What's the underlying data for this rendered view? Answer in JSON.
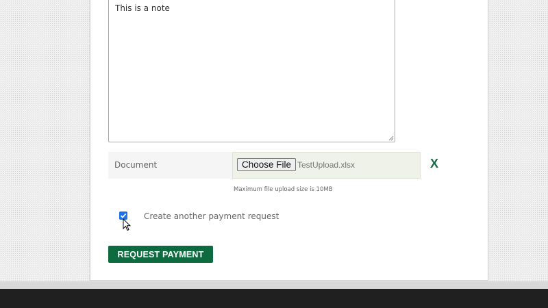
{
  "notes": {
    "value": "This is a note"
  },
  "document": {
    "label": "Document",
    "choose_label": "Choose File",
    "file_name": "TestUpload.xlsx",
    "remove_label": "X",
    "hint": "Maximum file upload size is 10MB"
  },
  "options": {
    "create_another_label": "Create another payment request",
    "create_another_checked": true
  },
  "actions": {
    "submit_label": "REQUEST PAYMENT"
  },
  "colors": {
    "brand_green": "#0e6b3f",
    "checkbox_blue": "#1a73e8"
  }
}
